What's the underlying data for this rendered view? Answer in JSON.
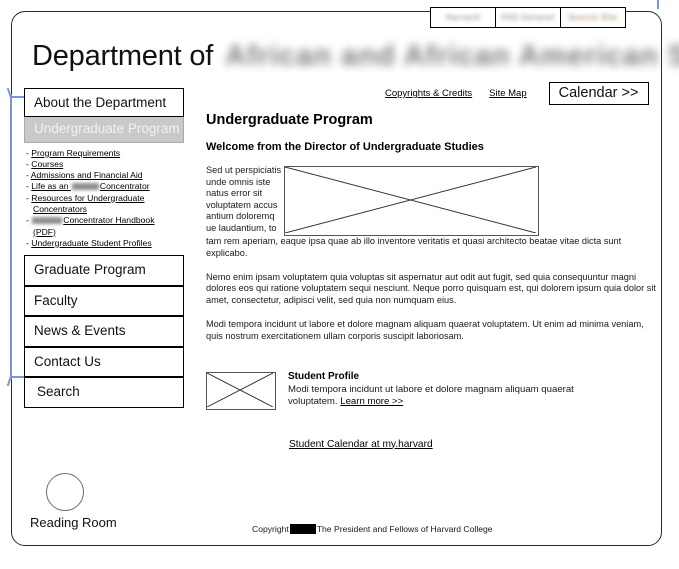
{
  "page": {
    "masthead_prefix": "Department of",
    "masthead_redacted": "African and African American Studies"
  },
  "topright": {
    "boxes": [
      {
        "text": "Harvard"
      },
      {
        "text": "FAS Intranet"
      },
      {
        "text": "Search Site"
      }
    ]
  },
  "utility_nav": {
    "links": [
      {
        "label": "Copyrights & Credits"
      },
      {
        "label": "Site Map"
      }
    ],
    "calendar_label": "Calendar >>"
  },
  "sidebar": {
    "items": [
      {
        "label": "About the Department",
        "active": false
      },
      {
        "label": "Undergraduate Program",
        "active": true
      },
      {
        "label": "Graduate Program",
        "active": false
      },
      {
        "label": "Faculty",
        "active": false
      },
      {
        "label": "News & Events",
        "active": false
      },
      {
        "label": "Contact Us",
        "active": false
      },
      {
        "label": "Search",
        "active": false
      }
    ],
    "sublinks": [
      {
        "prefix": "- ",
        "text": "Program Requirements"
      },
      {
        "prefix": "- ",
        "text": "Courses"
      },
      {
        "prefix": "- ",
        "text": "Admissions and Financial Aid"
      },
      {
        "prefix": "- ",
        "text": "Life as an ",
        "redacted": true,
        "suffix": "Concentrator"
      },
      {
        "prefix": "- ",
        "text": "Resources for Undergraduate",
        "continuation": "Concentrators"
      },
      {
        "prefix": "- ",
        "redacted_lead": true,
        "text": "Concentrator Handbook",
        "continuation": "(PDF)"
      },
      {
        "prefix": "- ",
        "text": "Undergraduate Student Profiles"
      }
    ]
  },
  "main": {
    "title": "Undergraduate Program",
    "subtitle": "Welcome from the Director of Undergraduate Studies",
    "intro_column": "Sed ut perspiciatis unde omnis iste natus error sit voluptatem accus antium doloremq ue laudantium, to",
    "intro_wrap": "tam rem aperiam, eaque ipsa quae ab illo inventore veritatis et quasi architecto beatae vitae dicta sunt explicabo.",
    "paragraph_2": "Nemo enim ipsam voluptatem quia voluptas sit aspernatur aut odit aut fugit, sed quia consequuntur magni dolores eos qui ratione voluptatem sequi nesciunt. Neque porro quisquam est, qui dolorem ipsum quia dolor sit amet, consectetur, adipisci velit, sed quia non numquam eius.",
    "paragraph_3": "Modi tempora incidunt ut labore et dolore magnam aliquam quaerat voluptatem. Ut enim ad minima veniam, quis nostrum exercitationem ullam corporis suscipit laboriosam.",
    "hero_image_alt": "image-placeholder"
  },
  "profile": {
    "title": "Student Profile",
    "body": "Modi tempora incidunt ut labore et dolore magnam aliquam quaerat voluptatem. ",
    "learn_more": "Learn more >>",
    "image_alt": "image-placeholder"
  },
  "calendar_link": {
    "label": "Student Calendar at my.harvard"
  },
  "reading_room": {
    "label": "Reading Room"
  },
  "footer": {
    "prefix": "Copyright",
    "suffix": "The President and Fellows of Harvard College"
  },
  "colors": {
    "frame": "#2b2b2b",
    "annotation_blue": "#7a93e0",
    "active_nav_bg": "#c9c9c9",
    "active_nav_text": "#f2f2f2"
  }
}
